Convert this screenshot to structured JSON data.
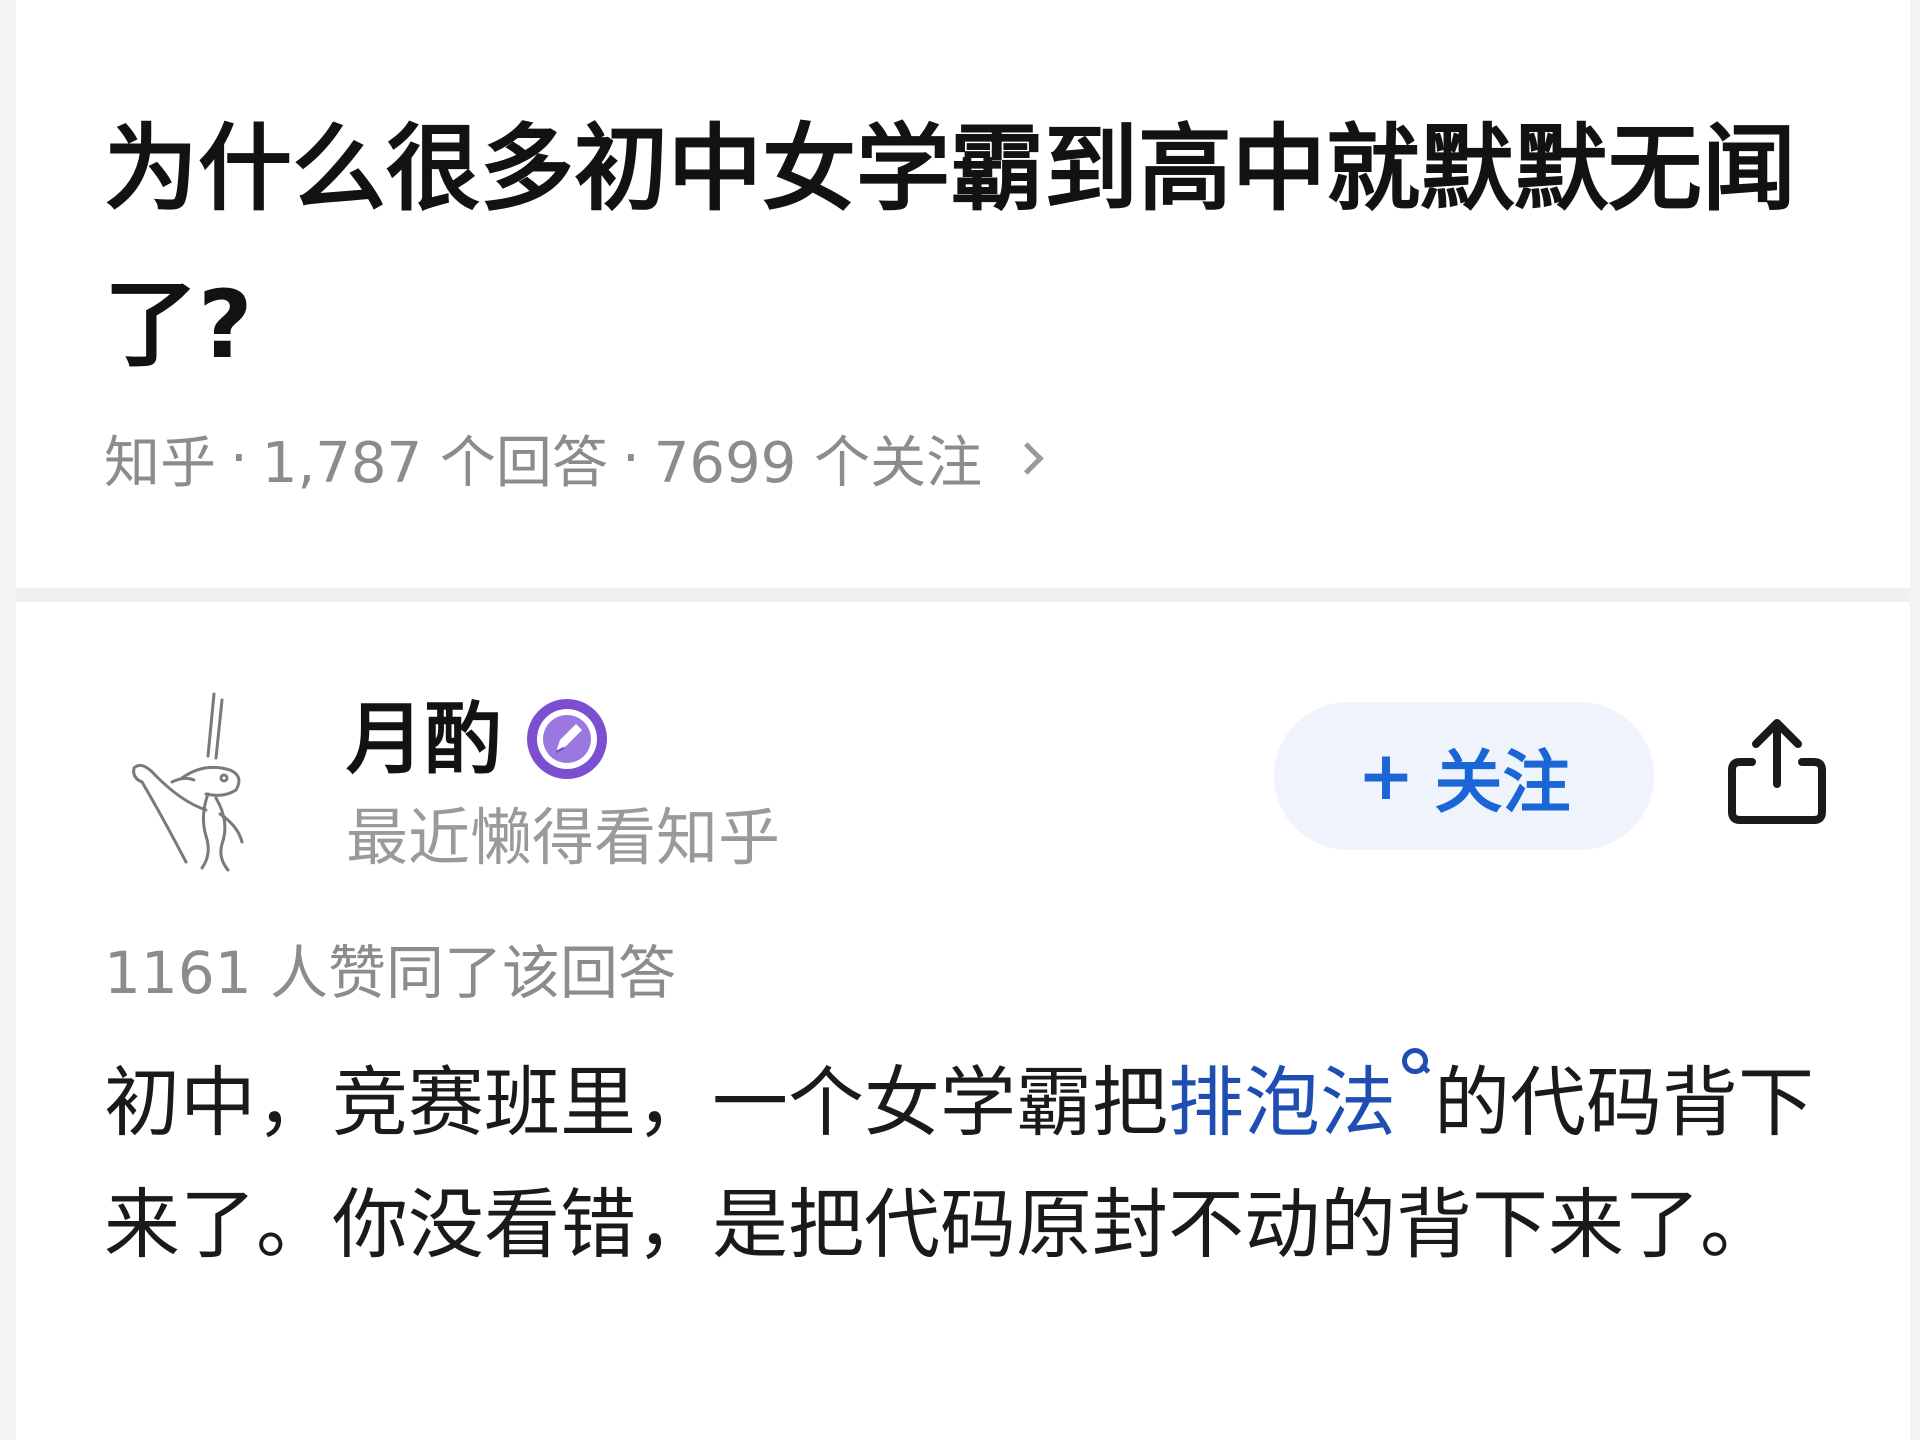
{
  "question": {
    "title": "为什么很多初中女学霸到高中就默默无闻了?",
    "source": "知乎",
    "separator": "·",
    "answers_count": "1,787 个回答",
    "followers_count": "7699 个关注"
  },
  "answer": {
    "author_name": "月酌",
    "author_bio": "最近懒得看知乎",
    "follow_button_plus": "+",
    "follow_button_label": "关注",
    "upvote_text": "1161 人赞同了该回答",
    "content": {
      "part1": "初中，竞赛班里，一个女学霸把",
      "link_text": "排泡法",
      "part2": "的代码背下来了。你没看错，是把代码原封不动的背下来了。"
    }
  },
  "colors": {
    "link_blue": "#1f4eb3",
    "follow_blue": "#1a66d6",
    "follow_bg": "#eef3fc",
    "meta_gray": "#8c8c8c",
    "badge_purple": "#7b4fd0"
  },
  "icons": {
    "meta_chevron": "chevron-right-icon",
    "badge": "verified-pen-badge-icon",
    "share": "share-icon",
    "search": "search-icon"
  }
}
